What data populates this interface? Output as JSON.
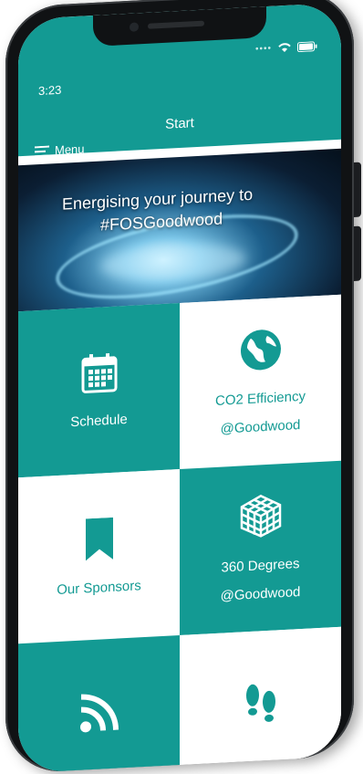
{
  "status": {
    "time": "3:23"
  },
  "header": {
    "title": "Start",
    "menu_label": "Menu"
  },
  "banner": {
    "line1": "Energising your journey to",
    "line2": "#FOSGoodwood"
  },
  "tiles": [
    {
      "label": "Schedule",
      "sub": ""
    },
    {
      "label": "CO2 Efficiency",
      "sub": "@Goodwood"
    },
    {
      "label": "Our Sponsors",
      "sub": ""
    },
    {
      "label": "360 Degrees",
      "sub": "@Goodwood"
    },
    {
      "label": "",
      "sub": ""
    },
    {
      "label": "",
      "sub": ""
    }
  ],
  "colors": {
    "accent": "#139a93",
    "background": "#ffffff"
  },
  "icons": [
    "calendar-icon",
    "globe-icon",
    "bookmark-icon",
    "cube-icon",
    "rss-icon",
    "footsteps-icon"
  ]
}
